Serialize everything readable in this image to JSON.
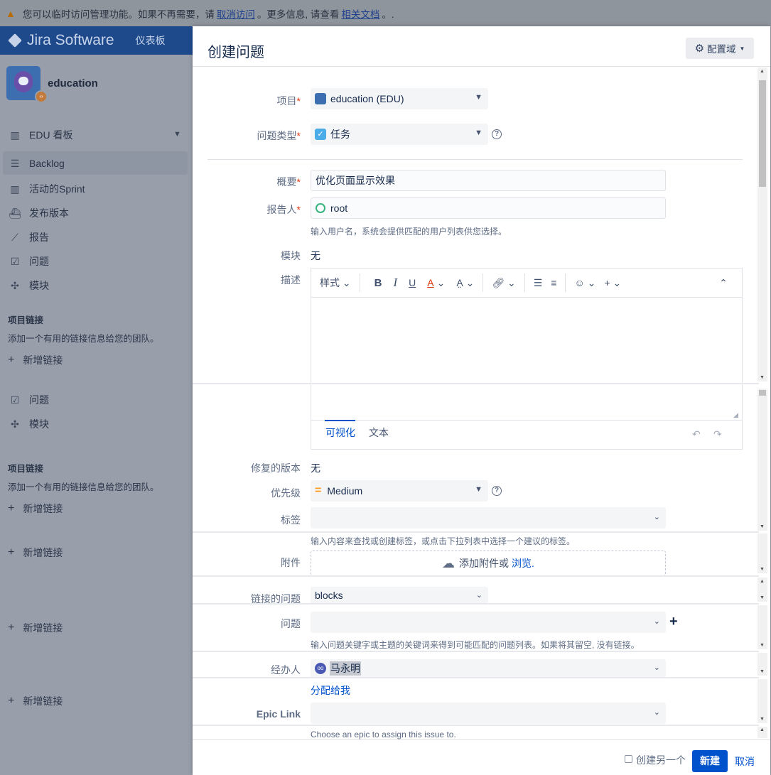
{
  "banner": {
    "text_before": "您可以临时访问管理功能。如果不再需要，请",
    "link1": "取消访问",
    "text_mid": "。更多信息, 请查看",
    "link2": "相关文档",
    "text_after": "。."
  },
  "topnav": {
    "app_name": "Jira Software",
    "dashboard": "仪表板"
  },
  "sidebar": {
    "project_name": "education",
    "items": [
      {
        "label": "EDU 看板"
      },
      {
        "label": "Backlog"
      },
      {
        "label": "活动的Sprint"
      },
      {
        "label": "发布版本"
      },
      {
        "label": "报告"
      },
      {
        "label": "问题"
      },
      {
        "label": "模块"
      }
    ],
    "links_heading": "项目链接",
    "links_desc": "添加一个有用的链接信息给您的团队。",
    "add_link": "新增链接",
    "dup_items": [
      {
        "label": "问题"
      },
      {
        "label": "模块"
      }
    ]
  },
  "dialog": {
    "title": "创建问题",
    "config_button": "配置域",
    "fields": {
      "project": {
        "label": "项目",
        "value": "education (EDU)"
      },
      "issue_type": {
        "label": "问题类型",
        "value": "任务"
      },
      "summary": {
        "label": "概要",
        "value": "优化页面显示效果"
      },
      "reporter": {
        "label": "报告人",
        "value": "root",
        "hint": "输入用户名，系统会提供匹配的用户列表供您选择。"
      },
      "component": {
        "label": "模块",
        "value": "无"
      },
      "description": {
        "label": "描述"
      },
      "fix_version": {
        "label": "修复的版本",
        "value": "无"
      },
      "priority": {
        "label": "优先级",
        "value": "Medium"
      },
      "labels": {
        "label": "标签",
        "value": "",
        "hint": "输入内容来查找或创建标签，或点击下拉列表中选择一个建议的标签。"
      },
      "attachment": {
        "label": "附件",
        "text": "添加附件或",
        "link": "浏览."
      },
      "linked_issues": {
        "label": "链接的问题",
        "value": "blocks"
      },
      "issue": {
        "label": "问题",
        "value": "",
        "hint": "输入问题关键字或主题的关键词来得到可能匹配的问题列表。如果将其留空, 没有链接。"
      },
      "assignee": {
        "label": "经办人",
        "value": "马永明",
        "assign_me": "分配给我"
      },
      "epic_link": {
        "label": "Epic Link",
        "value": "",
        "hint": "Choose an epic to assign this issue to."
      }
    },
    "editor": {
      "style": "样式",
      "bold": "B",
      "italic": "I",
      "underline": "U",
      "text_color": "A",
      "tab_visual": "可视化",
      "tab_text": "文本"
    },
    "footer": {
      "create_another": "创建另一个",
      "create": "新建",
      "cancel": "取消"
    }
  },
  "colors": {
    "primary": "#0052cc",
    "required": "#de350b",
    "nav": "#1e4a8c"
  }
}
